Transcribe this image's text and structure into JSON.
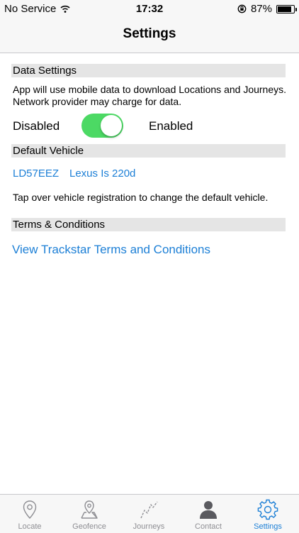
{
  "status_bar": {
    "carrier": "No Service",
    "time": "17:32",
    "battery": "87%",
    "battery_level": 0.87
  },
  "nav": {
    "title": "Settings"
  },
  "data_settings": {
    "header": "Data Settings",
    "description": "App will use mobile data to download Locations and Journeys. Network provider may charge for data.",
    "disabled_label": "Disabled",
    "enabled_label": "Enabled",
    "toggle_on": true
  },
  "default_vehicle": {
    "header": "Default Vehicle",
    "registration": "LD57EEZ",
    "model": "Lexus Is 220d",
    "hint": "Tap over vehicle registration to change the default vehicle."
  },
  "terms": {
    "header": "Terms & Conditions",
    "link": "View Trackstar Terms and Conditions"
  },
  "tabs": [
    {
      "label": "Locate",
      "icon": "location-pin-icon"
    },
    {
      "label": "Geofence",
      "icon": "map-pin-icon"
    },
    {
      "label": "Journeys",
      "icon": "journey-path-icon"
    },
    {
      "label": "Contact",
      "icon": "person-icon"
    },
    {
      "label": "Settings",
      "icon": "gear-icon",
      "active": true
    }
  ],
  "colors": {
    "accent": "#1c7fd6",
    "toggle_on": "#4cd964",
    "section_bg": "#e5e5e5",
    "tab_inactive": "#8e8e93"
  }
}
